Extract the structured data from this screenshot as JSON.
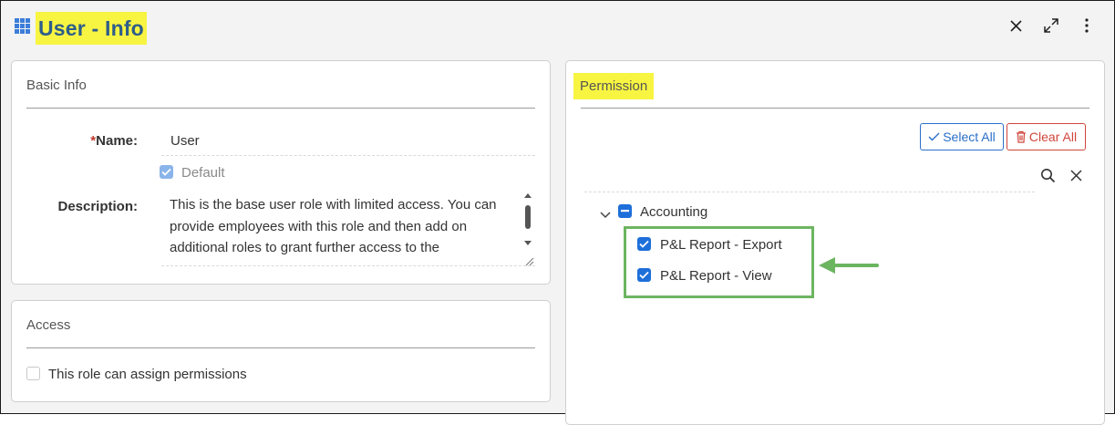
{
  "header": {
    "title": "User - Info",
    "icons": {
      "app": "grid-icon",
      "close": "close-icon",
      "expand": "expand-icon",
      "menu": "kebab-menu-icon"
    }
  },
  "basic_info": {
    "title": "Basic Info",
    "name_required_mark": "*",
    "name_label": "Name:",
    "name_value": "User",
    "default_label": "Default",
    "default_checked": true,
    "description_label": "Description:",
    "description_value": "This is the base user role with limited access.  You can provide employees with this role and then add on additional roles to grant further access to the"
  },
  "access": {
    "title": "Access",
    "assign_permissions_label": "This role can assign permissions",
    "assign_permissions_checked": false
  },
  "permission": {
    "title": "Permission",
    "select_all_label": "Select All",
    "clear_all_label": "Clear All",
    "tree": {
      "group_label": "Accounting",
      "group_state": "indeterminate",
      "items": [
        {
          "label": "P&L Report - Export",
          "checked": true
        },
        {
          "label": "P&L Report - View",
          "checked": true
        }
      ]
    }
  },
  "colors": {
    "accent": "#1e6fd9",
    "highlight": "#f8f442",
    "title_text": "#2d5d8a",
    "annotation_green": "#6cb560",
    "danger": "#d0453b"
  }
}
